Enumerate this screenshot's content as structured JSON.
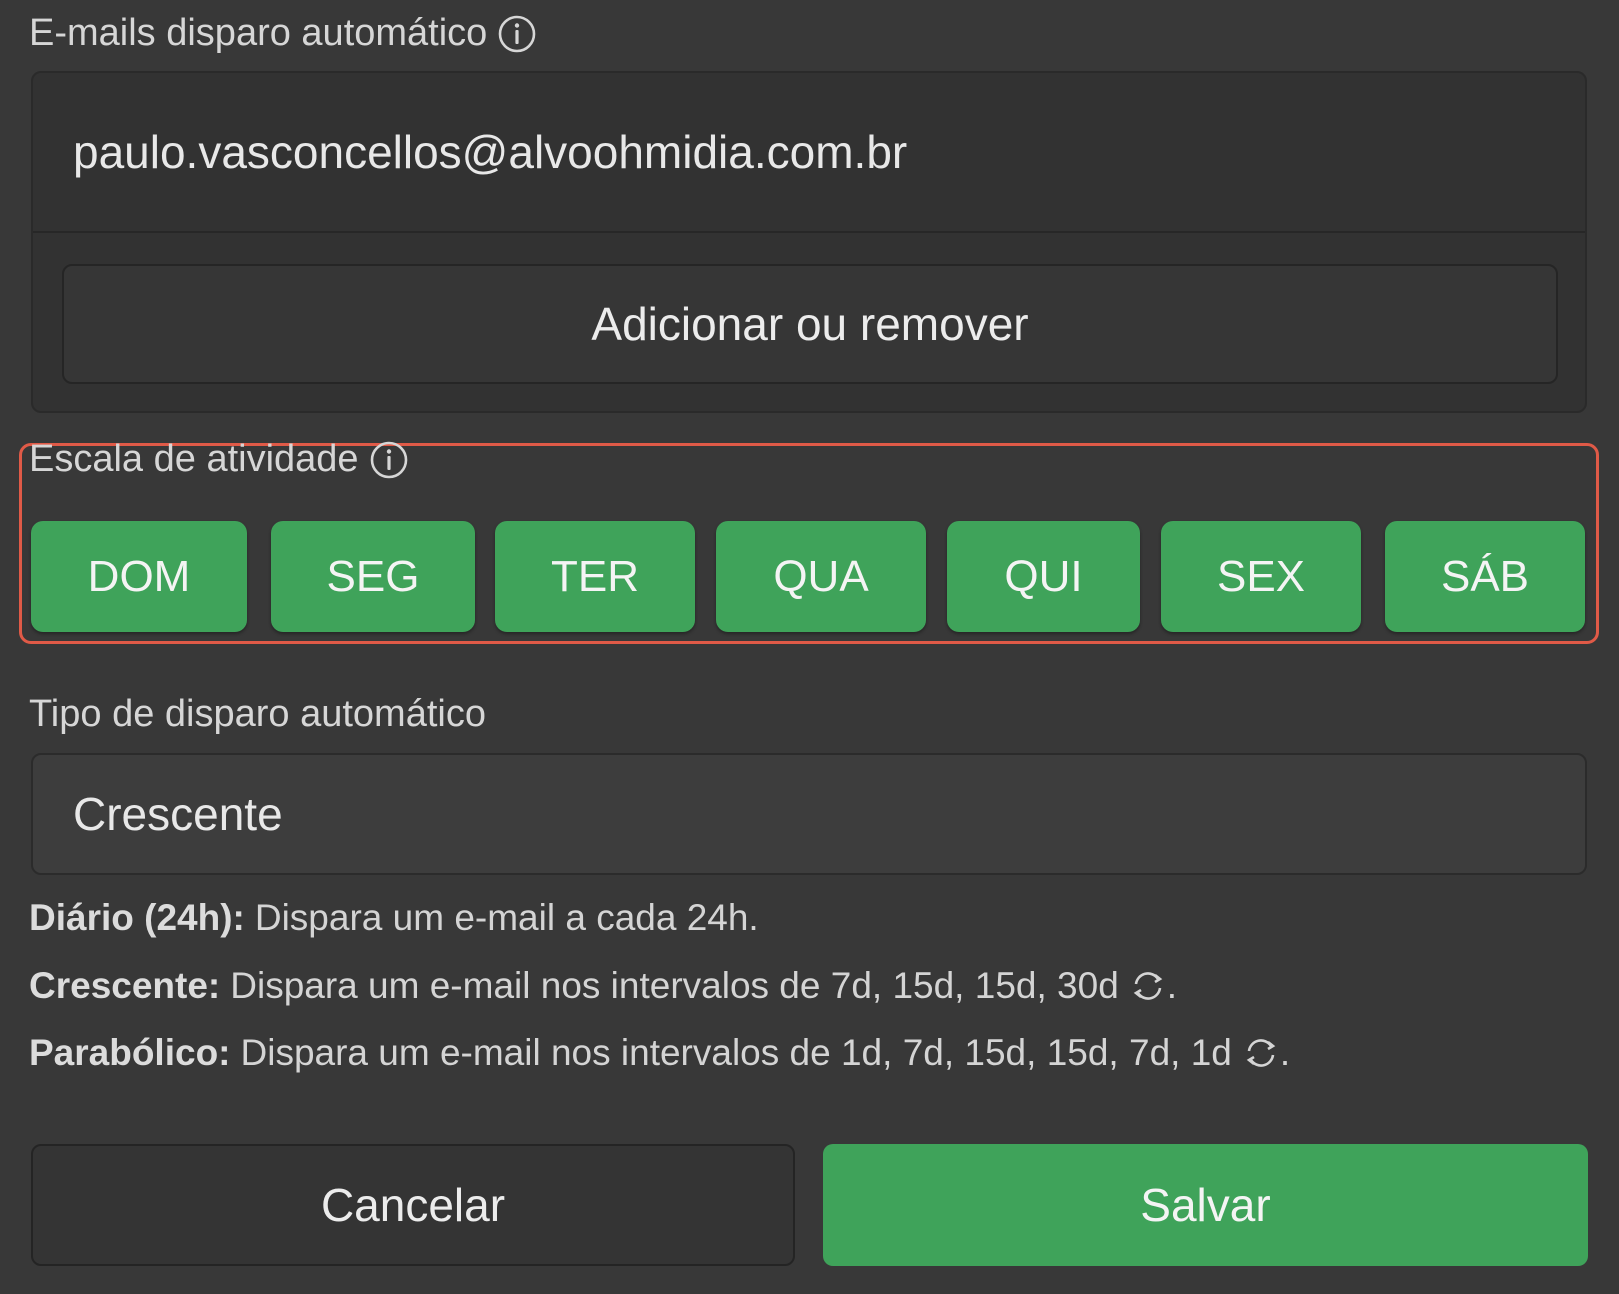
{
  "emails_section": {
    "label": "E-mails disparo automático",
    "emails": [
      "paulo.vasconcellos@alvoohmidia.com.br"
    ],
    "add_remove_label": "Adicionar ou remover"
  },
  "activity_section": {
    "label": "Escala de atividade",
    "highlight_color": "#e05a47",
    "active_color": "#3fa35a",
    "days": [
      {
        "label": "DOM",
        "active": true
      },
      {
        "label": "SEG",
        "active": true
      },
      {
        "label": "TER",
        "active": true
      },
      {
        "label": "QUA",
        "active": true
      },
      {
        "label": "QUI",
        "active": true
      },
      {
        "label": "SEX",
        "active": true
      },
      {
        "label": "SÁB",
        "active": true
      }
    ]
  },
  "trigger_type": {
    "label": "Tipo de disparo automático",
    "selected": "Crescente"
  },
  "descriptions": [
    {
      "term": "Diário (24h):",
      "text": "Dispara um e-mail a cada 24h.",
      "cycle_icon": false
    },
    {
      "term": "Crescente:",
      "text": "Dispara um e-mail nos intervalos de 7d, 15d, 15d, 30d",
      "cycle_icon": true
    },
    {
      "term": "Parabólico:",
      "text": "Dispara um e-mail nos intervalos de 1d, 7d, 15d, 15d, 7d, 1d",
      "cycle_icon": true
    }
  ],
  "actions": {
    "cancel_label": "Cancelar",
    "save_label": "Salvar"
  }
}
